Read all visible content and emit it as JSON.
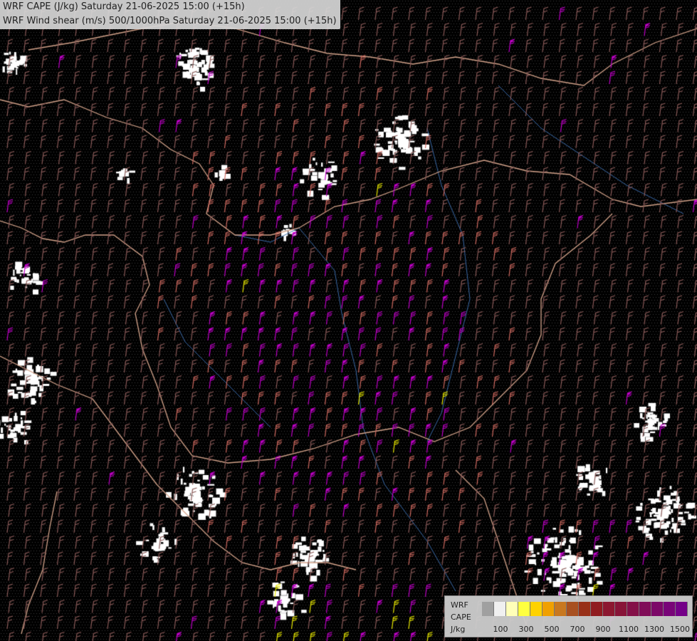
{
  "title": {
    "line1": "WRF CAPE (J/kg) Saturday 21-06-2025 15:00 (+15h)",
    "line2": "WRF Wind shear (m/s) 500/1000hPa Saturday 21-06-2025 15:00 (+15h)"
  },
  "legend": {
    "label_wrf": "WRF",
    "label_cape": "CAPE",
    "label_unit": "J/kg",
    "colors": [
      "#a0a0a0",
      "#f0f0f0",
      "#ffffb8",
      "#ffff40",
      "#ffd200",
      "#f0a000",
      "#c87820",
      "#a85020",
      "#983018",
      "#901c20",
      "#8c1830",
      "#881438",
      "#841048",
      "#800c58",
      "#7c0868",
      "#780478",
      "#740088"
    ],
    "ticks": [
      "100",
      "300",
      "500",
      "700",
      "900",
      "1100",
      "1300",
      "1500"
    ]
  },
  "map": {
    "background": "#000000",
    "wind_barb_colors": {
      "low_shear": "#8a5a58",
      "medium_shear": "#d06a60",
      "high_shear": "#c000c8",
      "very_high_shear": "#e8e800"
    },
    "border_color": "#d4a38a",
    "river_color": "#3a6aa8"
  }
}
